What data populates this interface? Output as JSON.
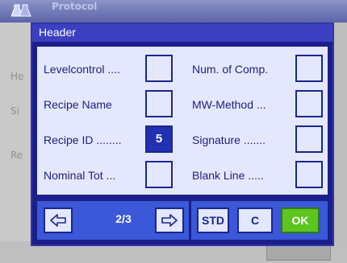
{
  "background": {
    "title": "Protocol",
    "side_labels": [
      "He",
      "Si",
      "Re"
    ]
  },
  "dialog": {
    "title": "Header",
    "left_items": [
      {
        "label": "Levelcontrol ....",
        "value": ""
      },
      {
        "label": "Recipe Name",
        "value": ""
      },
      {
        "label": "Recipe ID ........",
        "value": "5"
      },
      {
        "label": "Nominal Tot ...",
        "value": ""
      }
    ],
    "right_items": [
      {
        "label": "Num. of Comp.",
        "value": ""
      },
      {
        "label": "MW-Method ...",
        "value": ""
      },
      {
        "label": "Signature .......",
        "value": ""
      },
      {
        "label": "Blank Line .....",
        "value": ""
      }
    ],
    "footer": {
      "page": "2/3",
      "std_label": "STD",
      "c_label": "C",
      "ok_label": "OK"
    }
  },
  "colors": {
    "dialog_bg": "#1b1f8a",
    "body_bg": "#e4e8ff",
    "footer_bg": "#3a58d8",
    "selected": "#2230b4",
    "ok": "#5cc61f"
  },
  "icons": [
    "flask-icon",
    "arrow-left-icon",
    "arrow-right-icon"
  ]
}
